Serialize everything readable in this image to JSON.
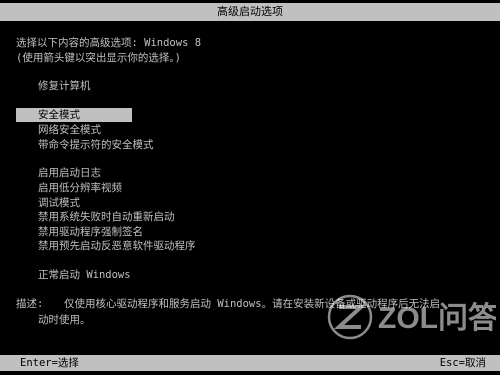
{
  "window": {
    "title": "高级启动选项"
  },
  "prompt": {
    "line1": "选择以下内容的高级选项: Windows 8",
    "line2": "(使用箭头键以突出显示你的选择。)"
  },
  "menu": {
    "items": [
      {
        "label": "修复计算机",
        "selected": false
      },
      {
        "label": "安全模式",
        "selected": true
      },
      {
        "label": "网络安全模式",
        "selected": false
      },
      {
        "label": "带命令提示符的安全模式",
        "selected": false
      },
      {
        "label": "启用启动日志",
        "selected": false
      },
      {
        "label": "启用低分辨率视频",
        "selected": false
      },
      {
        "label": "调试模式",
        "selected": false
      },
      {
        "label": "禁用系统失败时自动重新启动",
        "selected": false
      },
      {
        "label": "禁用驱动程序强制签名",
        "selected": false
      },
      {
        "label": "禁用预先启动反恶意软件驱动程序",
        "selected": false
      },
      {
        "label": "正常启动 Windows",
        "selected": false
      }
    ]
  },
  "description": {
    "label": "描述:",
    "line1": "仅使用核心驱动程序和服务启动 Windows。请在安装新设备或驱动程序后无法启",
    "line2": "动时使用。"
  },
  "footer": {
    "left": "Enter=选择",
    "right": "Esc=取消"
  },
  "watermark": {
    "text": "ZOL问答"
  }
}
